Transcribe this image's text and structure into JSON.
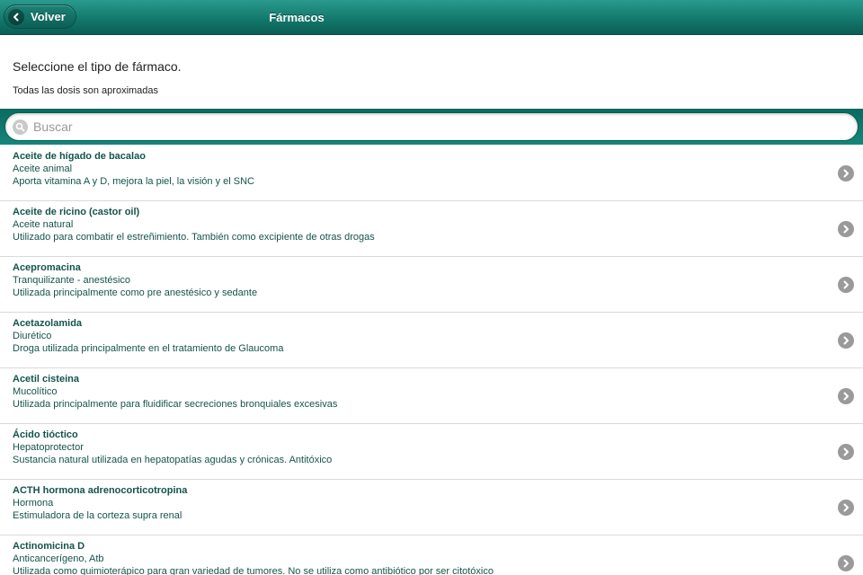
{
  "header": {
    "back_label": "Volver",
    "title": "Fármacos"
  },
  "intro": {
    "heading": "Seleccione el tipo de fármaco.",
    "note": "Todas las dosis son aproximadas"
  },
  "search": {
    "placeholder": "Buscar",
    "value": ""
  },
  "items": [
    {
      "name": "Aceite de hígado de bacalao",
      "type": "Aceite animal",
      "desc": "Aporta vitamina A y D, mejora la piel, la visión y el SNC"
    },
    {
      "name": "Aceite de ricino (castor oil)",
      "type": "Aceite natural",
      "desc": "Utilizado para combatir el estreñimiento. También como excipiente de otras drogas"
    },
    {
      "name": "Acepromacina",
      "type": "Tranquilizante - anestésico",
      "desc": "Utilizada principalmente como pre anestésico y sedante"
    },
    {
      "name": "Acetazolamida",
      "type": "Diurético",
      "desc": "Droga utilizada principalmente en el tratamiento de Glaucoma"
    },
    {
      "name": "Acetil cisteina",
      "type": "Mucolítico",
      "desc": "Utilizada principalmente para fluidificar secreciones bronquiales excesivas"
    },
    {
      "name": "Ácido tióctico",
      "type": "Hepatoprotector",
      "desc": "Sustancia natural utilizada en hepatopatías agudas y crónicas. Antitóxico"
    },
    {
      "name": "ACTH hormona adrenocorticotropina",
      "type": "Hormona",
      "desc": "Estimuladora de la corteza supra renal"
    },
    {
      "name": "Actinomicina D",
      "type": "Anticancerígeno, Atb",
      "desc": "Utilizada como quimioterápico para gran variedad de tumores. No se utiliza como antibiótico por ser citotóxico"
    }
  ]
}
